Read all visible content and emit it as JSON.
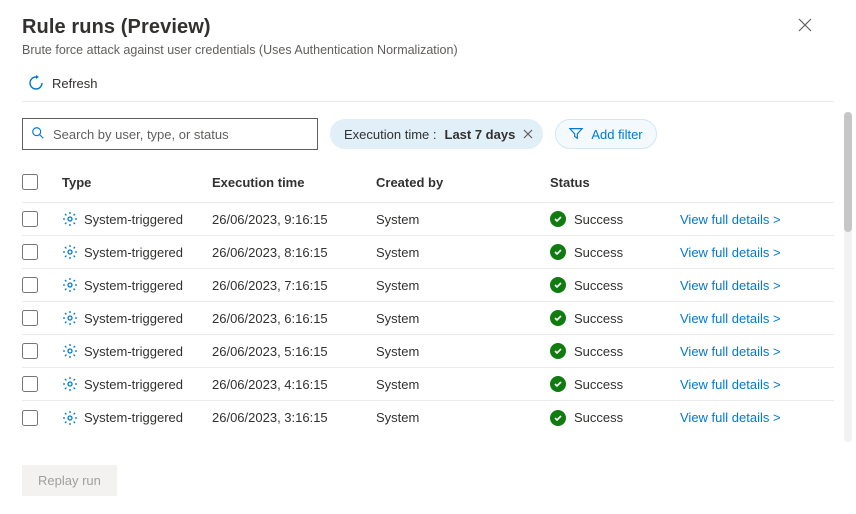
{
  "header": {
    "title": "Rule runs (Preview)",
    "subtitle": "Brute force attack against user credentials (Uses Authentication Normalization)"
  },
  "toolbar": {
    "refresh_label": "Refresh",
    "search_placeholder": "Search by user, type, or status",
    "filter_prefix": "Execution time : ",
    "filter_value": "Last 7 days",
    "add_filter_label": "Add filter"
  },
  "columns": {
    "type": "Type",
    "time": "Execution time",
    "by": "Created by",
    "status": "Status"
  },
  "rows": [
    {
      "type": "System-triggered",
      "time": "26/06/2023, 9:16:15",
      "by": "System",
      "status": "Success",
      "link": "View full details >"
    },
    {
      "type": "System-triggered",
      "time": "26/06/2023, 8:16:15",
      "by": "System",
      "status": "Success",
      "link": "View full details >"
    },
    {
      "type": "System-triggered",
      "time": "26/06/2023, 7:16:15",
      "by": "System",
      "status": "Success",
      "link": "View full details >"
    },
    {
      "type": "System-triggered",
      "time": "26/06/2023, 6:16:15",
      "by": "System",
      "status": "Success",
      "link": "View full details >"
    },
    {
      "type": "System-triggered",
      "time": "26/06/2023, 5:16:15",
      "by": "System",
      "status": "Success",
      "link": "View full details >"
    },
    {
      "type": "System-triggered",
      "time": "26/06/2023, 4:16:15",
      "by": "System",
      "status": "Success",
      "link": "View full details >"
    },
    {
      "type": "System-triggered",
      "time": "26/06/2023, 3:16:15",
      "by": "System",
      "status": "Success",
      "link": "View full details >"
    }
  ],
  "footer": {
    "replay_label": "Replay run"
  }
}
